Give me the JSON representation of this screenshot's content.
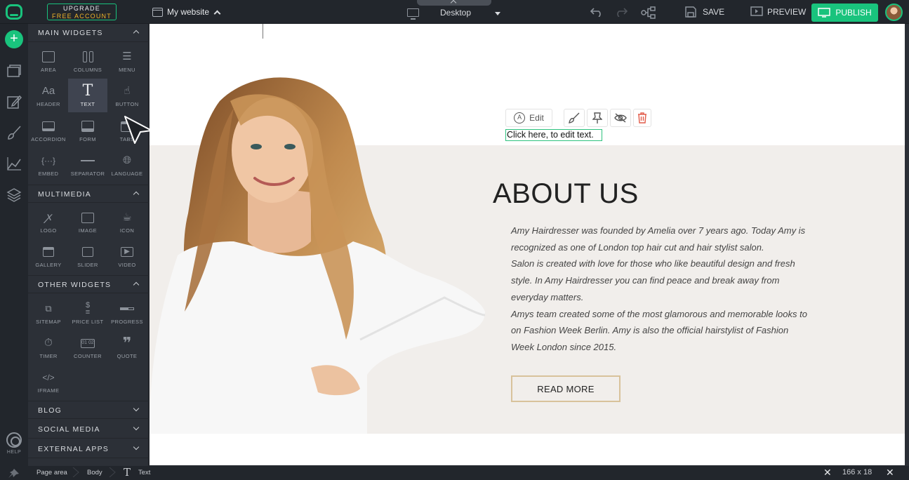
{
  "topbar": {
    "upgrade_line1": "UPGRADE",
    "upgrade_line2": "FREE ACCOUNT",
    "site_name": "My website",
    "device": "Desktop",
    "save_label": "SAVE",
    "preview_label": "PREVIEW",
    "publish_label": "PUBLISH"
  },
  "rail": {
    "help_label": "HELP"
  },
  "panel": {
    "main_widgets_title": "MAIN WIDGETS",
    "main_widgets": [
      "AREA",
      "COLUMNS",
      "MENU",
      "HEADER",
      "TEXT",
      "BUTTON",
      "ACCORDION",
      "FORM",
      "TABS",
      "EMBED",
      "SEPARATOR",
      "LANGUAGE"
    ],
    "multimedia_title": "MULTIMEDIA",
    "multimedia": [
      "LOGO",
      "IMAGE",
      "ICON",
      "GALLERY",
      "SLIDER",
      "VIDEO"
    ],
    "other_widgets_title": "OTHER WIDGETS",
    "other_widgets": [
      "SITEMAP",
      "PRICE LIST",
      "PROGRESS",
      "TIMER",
      "COUNTER",
      "QUOTE",
      "IFRAME"
    ],
    "blog_title": "BLOG",
    "social_title": "SOCIAL MEDIA",
    "external_title": "EXTERNAL APPS",
    "active_widget": "TEXT"
  },
  "canvas": {
    "edit_label": "Edit",
    "placeholder_text": "Click here, to edit text.",
    "about_title": "ABOUT US",
    "about_paragraphs": [
      "Amy Hairdresser was founded by Amelia over 7 years ago. Today Amy is recognized as one of London top hair cut and hair stylist salon.",
      "Salon is created with love for those who like beautiful design and fresh style. In Amy Hairdresser you can find peace and break away from everyday matters.",
      "Amys team created some of the most glamorous and memorable looks to on Fashion Week Berlin. Amy is also the official hairstylist of Fashion Week London since 2015."
    ],
    "read_more_label": "READ MORE"
  },
  "statusbar": {
    "crumbs": [
      "Page area",
      "Body",
      "Text"
    ],
    "size": "166 x 18"
  },
  "colors": {
    "accent": "#19c37d",
    "upgrade_text": "#f0b429",
    "delete_icon": "#e25c4a",
    "read_more_border": "#d8c29b",
    "section_band": "#f1eeeb"
  }
}
